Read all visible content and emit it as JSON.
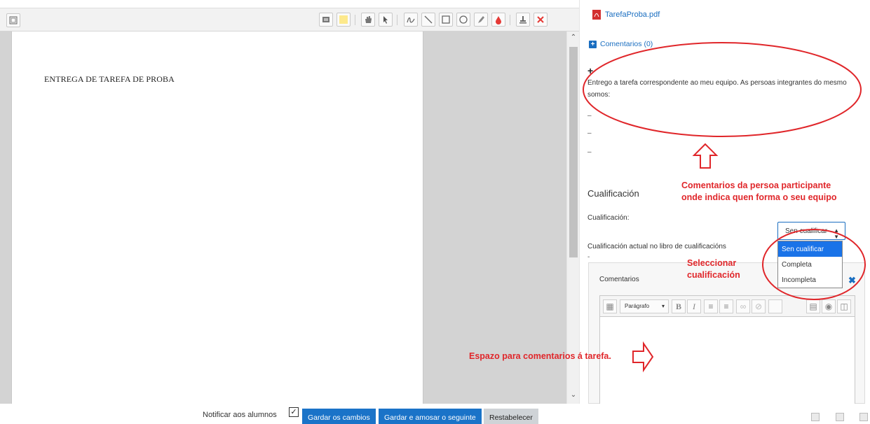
{
  "viewer": {
    "page_text": "ENTREGA DE TAREFA DE PROBA",
    "toolbar_icons": [
      "collapse-icon",
      "comment-icon",
      "highlight-color-icon",
      "hand-pan-icon",
      "select-arrow-icon",
      "pen-icon",
      "line-icon",
      "rectangle-icon",
      "oval-icon",
      "highlighter-icon",
      "ink-color-icon",
      "stamp-icon",
      "delete-icon"
    ]
  },
  "panel": {
    "file_name": "TarefaProba.pdf",
    "comments_link": "Comentarios (0)",
    "submission_text": "Entrego a tarefa correspondente ao meu equipo. As persoas integrantes do mesmo somos:",
    "dashes": [
      "–",
      "–",
      "–"
    ],
    "grade_heading": "Cualificación",
    "grade_label": "Cualificación:",
    "grade_selected": "Sen cualificar",
    "grade_options": [
      "Sen cualificar",
      "Completa",
      "Incompleta"
    ],
    "current_grade_label": "Cualificación actual no libro de cualificacións",
    "current_grade_value": "-",
    "feedback_label": "Comentarios",
    "editor_paragraph": "Parágrafo"
  },
  "annotations": {
    "participant_comments": "Comentarios da persoa participante\nonde indica quen forma o seu equipo",
    "select_grade": "Seleccionar\ncualificación",
    "feedback_space": "Espazo para comentarios á tarefa."
  },
  "bottom": {
    "notify_label": "Notificar aos alumnos",
    "notify_checked": true,
    "save_label": "Gardar os cambios",
    "save_next_label": "Gardar e amosar o seguinte",
    "reset_label": "Restabelecer"
  },
  "colors": {
    "accent": "#1a6ec0",
    "annotation": "#e0262a",
    "selected_option": "#1a73e8"
  }
}
